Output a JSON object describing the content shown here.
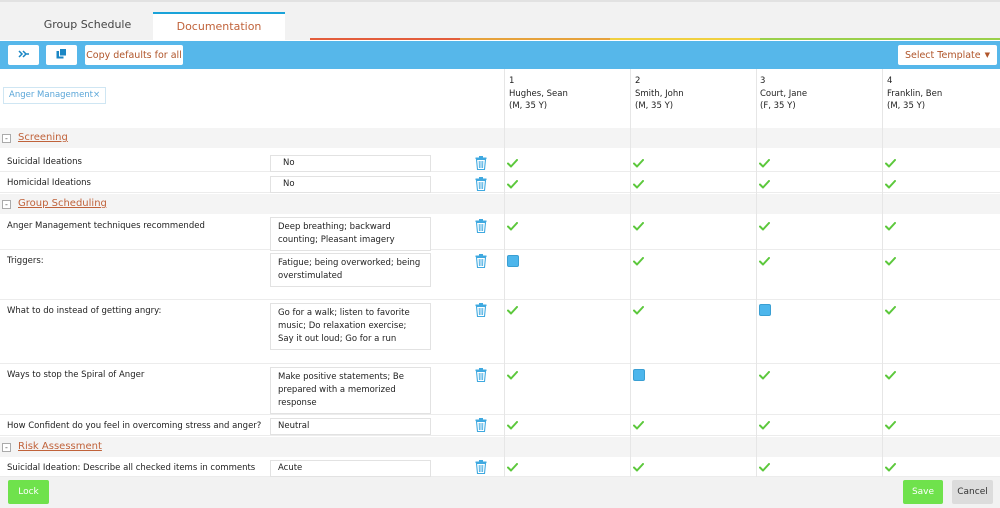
{
  "tabs": [
    {
      "label": "Group Schedule"
    },
    {
      "label": "Documentation"
    }
  ],
  "toolbar": {
    "collapse_icon": "collapse-icon",
    "copy_icon": "copy-icon",
    "copy_defaults_label": "Copy defaults for all",
    "select_template_label": "Select Template",
    "select_template_icon": "caret-down-icon"
  },
  "filter": {
    "label": "Anger Management"
  },
  "patients": [
    {
      "number": "1",
      "name": "Hughes, Sean",
      "info": "(M, 35 Y)"
    },
    {
      "number": "2",
      "name": "Smith, John",
      "info": "(M, 35 Y)"
    },
    {
      "number": "3",
      "name": "Court, Jane",
      "info": "(F, 35 Y)"
    },
    {
      "number": "4",
      "name": "Franklin, Ben",
      "info": "(M, 35 Y)"
    }
  ],
  "sections": {
    "screening": "Screening",
    "group_scheduling": "Group Scheduling",
    "risk_assessment": "Risk Assessment"
  },
  "questions": [
    {
      "label": "Suicidal Ideations",
      "answer": "No",
      "marks": [
        "check",
        "check",
        "check",
        "check"
      ]
    },
    {
      "label": "Homicidal Ideations",
      "answer": "No",
      "marks": [
        "check",
        "check",
        "check",
        "check"
      ]
    },
    {
      "label": "Anger Management techniques recommended",
      "answer": "Deep breathing; backward counting; Pleasant imagery",
      "marks": [
        "check",
        "check",
        "check",
        "check"
      ]
    },
    {
      "label": "Triggers:",
      "answer": "Fatigue; being overworked; being overstimulated",
      "marks": [
        "unchecked",
        "check",
        "check",
        "check"
      ]
    },
    {
      "label": "What to do instead of getting angry:",
      "answer": "Go for a walk; listen to favorite music; Do relaxation exercise; Say it out loud; Go for a run",
      "marks": [
        "check",
        "check",
        "unchecked",
        "check"
      ]
    },
    {
      "label": "Ways to stop the Spiral of Anger",
      "answer": "Make positive statements; Be prepared with a memorized response",
      "marks": [
        "check",
        "unchecked",
        "check",
        "check"
      ]
    },
    {
      "label": "How Confident do you feel in overcoming stress and anger?",
      "answer": "Neutral",
      "marks": [
        "check",
        "check",
        "check",
        "check"
      ]
    },
    {
      "label": "Suicidal Ideation: Describe all checked items in comments",
      "answer": "Acute",
      "marks": [
        "check",
        "check",
        "check",
        "check"
      ]
    }
  ],
  "footer": {
    "lock_label": "Lock",
    "save_label": "Save",
    "cancel_label": "Cancel"
  },
  "colors": {
    "accent_blue": "#56b7ea",
    "link_orange": "#c0623a",
    "check_green": "#5cc83c",
    "button_green": "#6fe24c"
  }
}
